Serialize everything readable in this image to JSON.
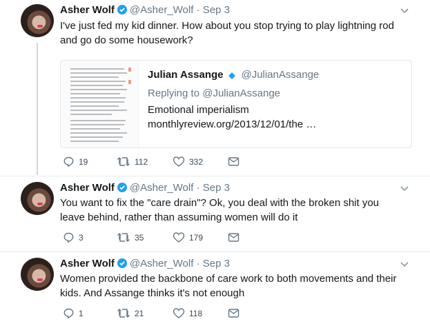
{
  "tweets": [
    {
      "name": "Asher Wolf",
      "handle": "@Asher_Wolf",
      "time": "· Sep 3",
      "text": "I've just fed my kid dinner. How about you stop trying to play lightning rod and go do some housework?",
      "quote": {
        "name": "Julian Assange",
        "handle": "@JulianAssange",
        "replying": "Replying to @JulianAssange",
        "text": "Emotional imperialism monthlyreview.org/2013/12/01/the …"
      },
      "replies": "19",
      "retweets": "112",
      "likes": "332"
    },
    {
      "name": "Asher Wolf",
      "handle": "@Asher_Wolf",
      "time": "· Sep 3",
      "text": "You want to fix the \"care drain\"? Ok, you deal with the broken shit you leave behind, rather than assuming women will do it",
      "replies": "3",
      "retweets": "35",
      "likes": "179"
    },
    {
      "name": "Asher Wolf",
      "handle": "@Asher_Wolf",
      "time": "· Sep 3",
      "text": "Women provided the backbone of care work to both movements and their kids. And Assange thinks it's not enough",
      "replies": "1",
      "retweets": "21",
      "likes": "118"
    }
  ],
  "colors": {
    "accent": "#1da1f2",
    "muted": "#657786",
    "thread": "#ccd6dd"
  }
}
